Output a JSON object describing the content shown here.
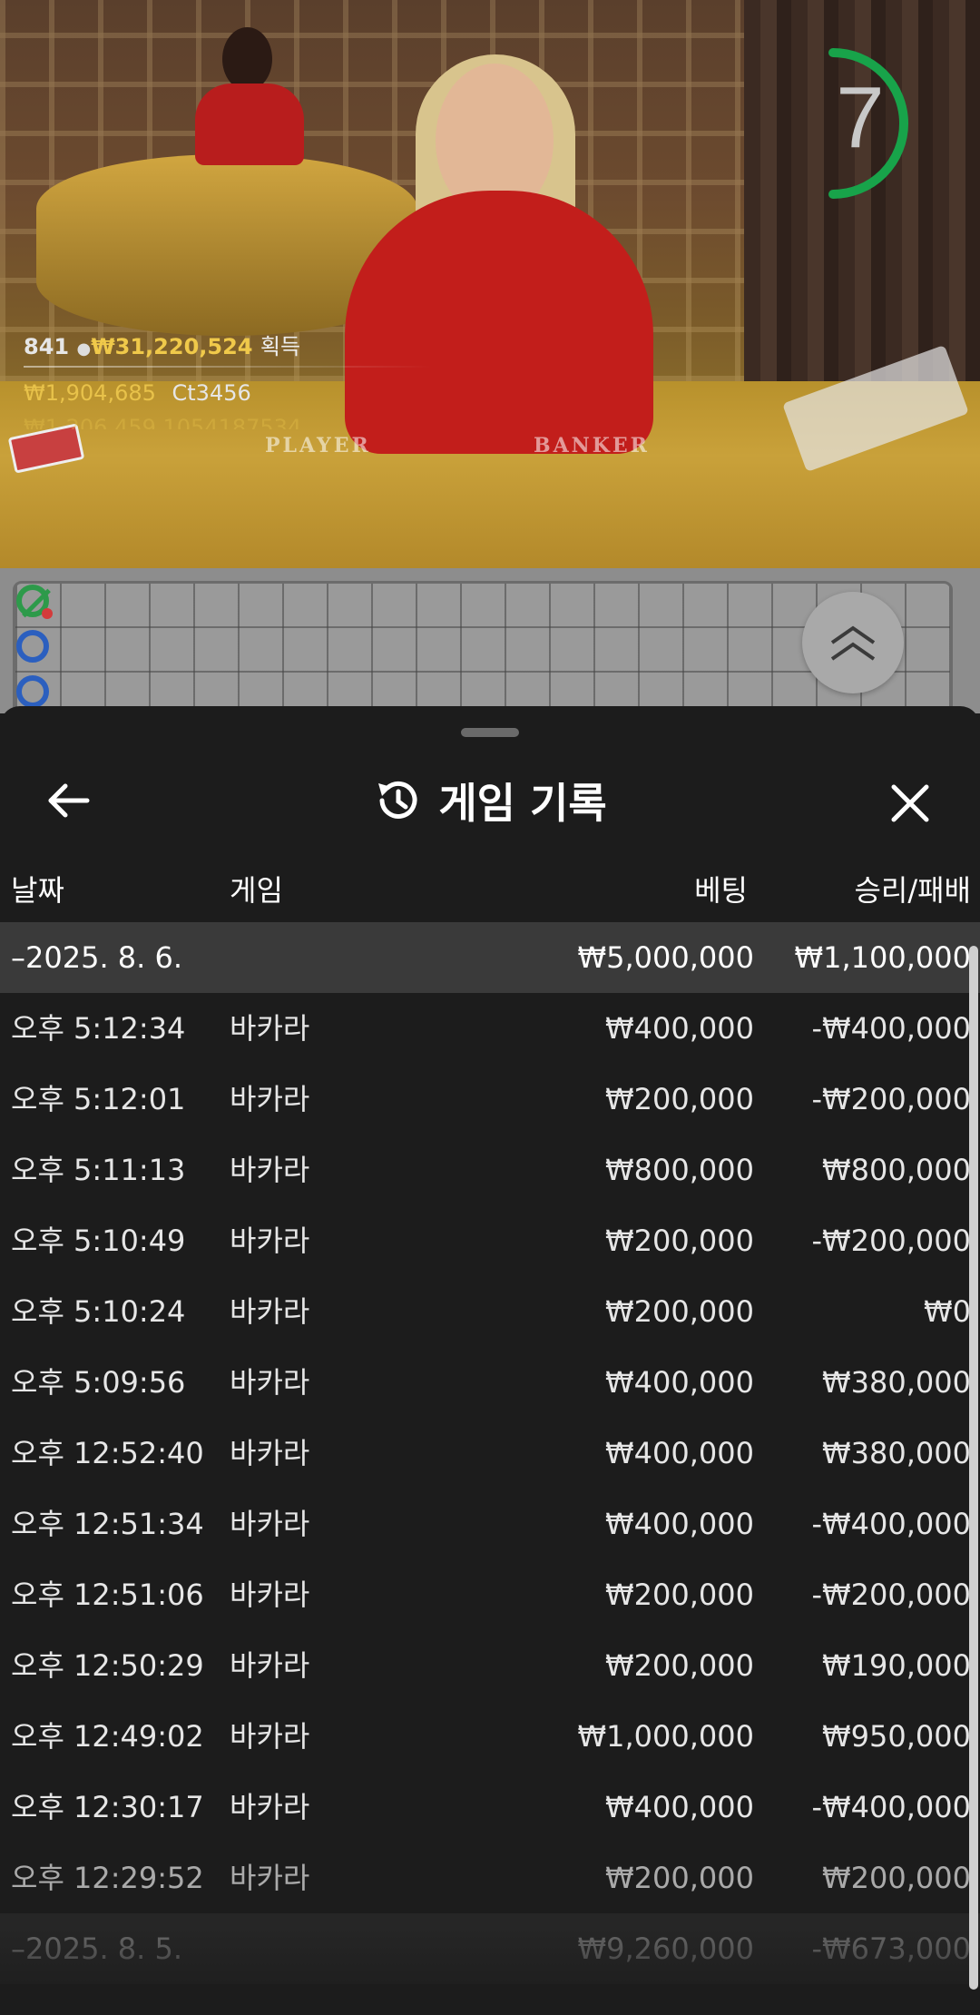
{
  "video": {
    "timer": "7",
    "stats": {
      "players": "841",
      "total_win": "₩31,220,524",
      "total_win_label": "획득",
      "top_win": "₩1,904,685",
      "top_win_user": "Ct3456",
      "next_win": "₩1,206,459",
      "next_win_user": "1054187534"
    },
    "table_labels": {
      "player": "PLAYER",
      "banker": "BANKER"
    }
  },
  "sheet": {
    "title": "게임 기록",
    "columns": {
      "date": "날짜",
      "game": "게임",
      "bet": "베팅",
      "win_loss": "승리/패배"
    },
    "group": {
      "date": "–2025. 8. 6.",
      "bet": "₩5,000,000",
      "win_loss": "₩1,100,000"
    },
    "rows": [
      {
        "time": "오후 5:12:34",
        "game": "바카라",
        "bet": "₩400,000",
        "win_loss": "-₩400,000"
      },
      {
        "time": "오후 5:12:01",
        "game": "바카라",
        "bet": "₩200,000",
        "win_loss": "-₩200,000"
      },
      {
        "time": "오후 5:11:13",
        "game": "바카라",
        "bet": "₩800,000",
        "win_loss": "₩800,000"
      },
      {
        "time": "오후 5:10:49",
        "game": "바카라",
        "bet": "₩200,000",
        "win_loss": "-₩200,000"
      },
      {
        "time": "오후 5:10:24",
        "game": "바카라",
        "bet": "₩200,000",
        "win_loss": "₩0"
      },
      {
        "time": "오후 5:09:56",
        "game": "바카라",
        "bet": "₩400,000",
        "win_loss": "₩380,000"
      },
      {
        "time": "오후 12:52:40",
        "game": "바카라",
        "bet": "₩400,000",
        "win_loss": "₩380,000"
      },
      {
        "time": "오후 12:51:34",
        "game": "바카라",
        "bet": "₩400,000",
        "win_loss": "-₩400,000"
      },
      {
        "time": "오후 12:51:06",
        "game": "바카라",
        "bet": "₩200,000",
        "win_loss": "-₩200,000"
      },
      {
        "time": "오후 12:50:29",
        "game": "바카라",
        "bet": "₩200,000",
        "win_loss": "₩190,000"
      },
      {
        "time": "오후 12:49:02",
        "game": "바카라",
        "bet": "₩1,000,000",
        "win_loss": "₩950,000"
      },
      {
        "time": "오후 12:30:17",
        "game": "바카라",
        "bet": "₩400,000",
        "win_loss": "-₩400,000"
      },
      {
        "time": "오후 12:29:52",
        "game": "바카라",
        "bet": "₩200,000",
        "win_loss": "₩200,000"
      }
    ],
    "next_group": {
      "date": "–2025. 8. 5.",
      "bet": "₩9,260,000",
      "win_loss": "-₩673,000"
    }
  }
}
